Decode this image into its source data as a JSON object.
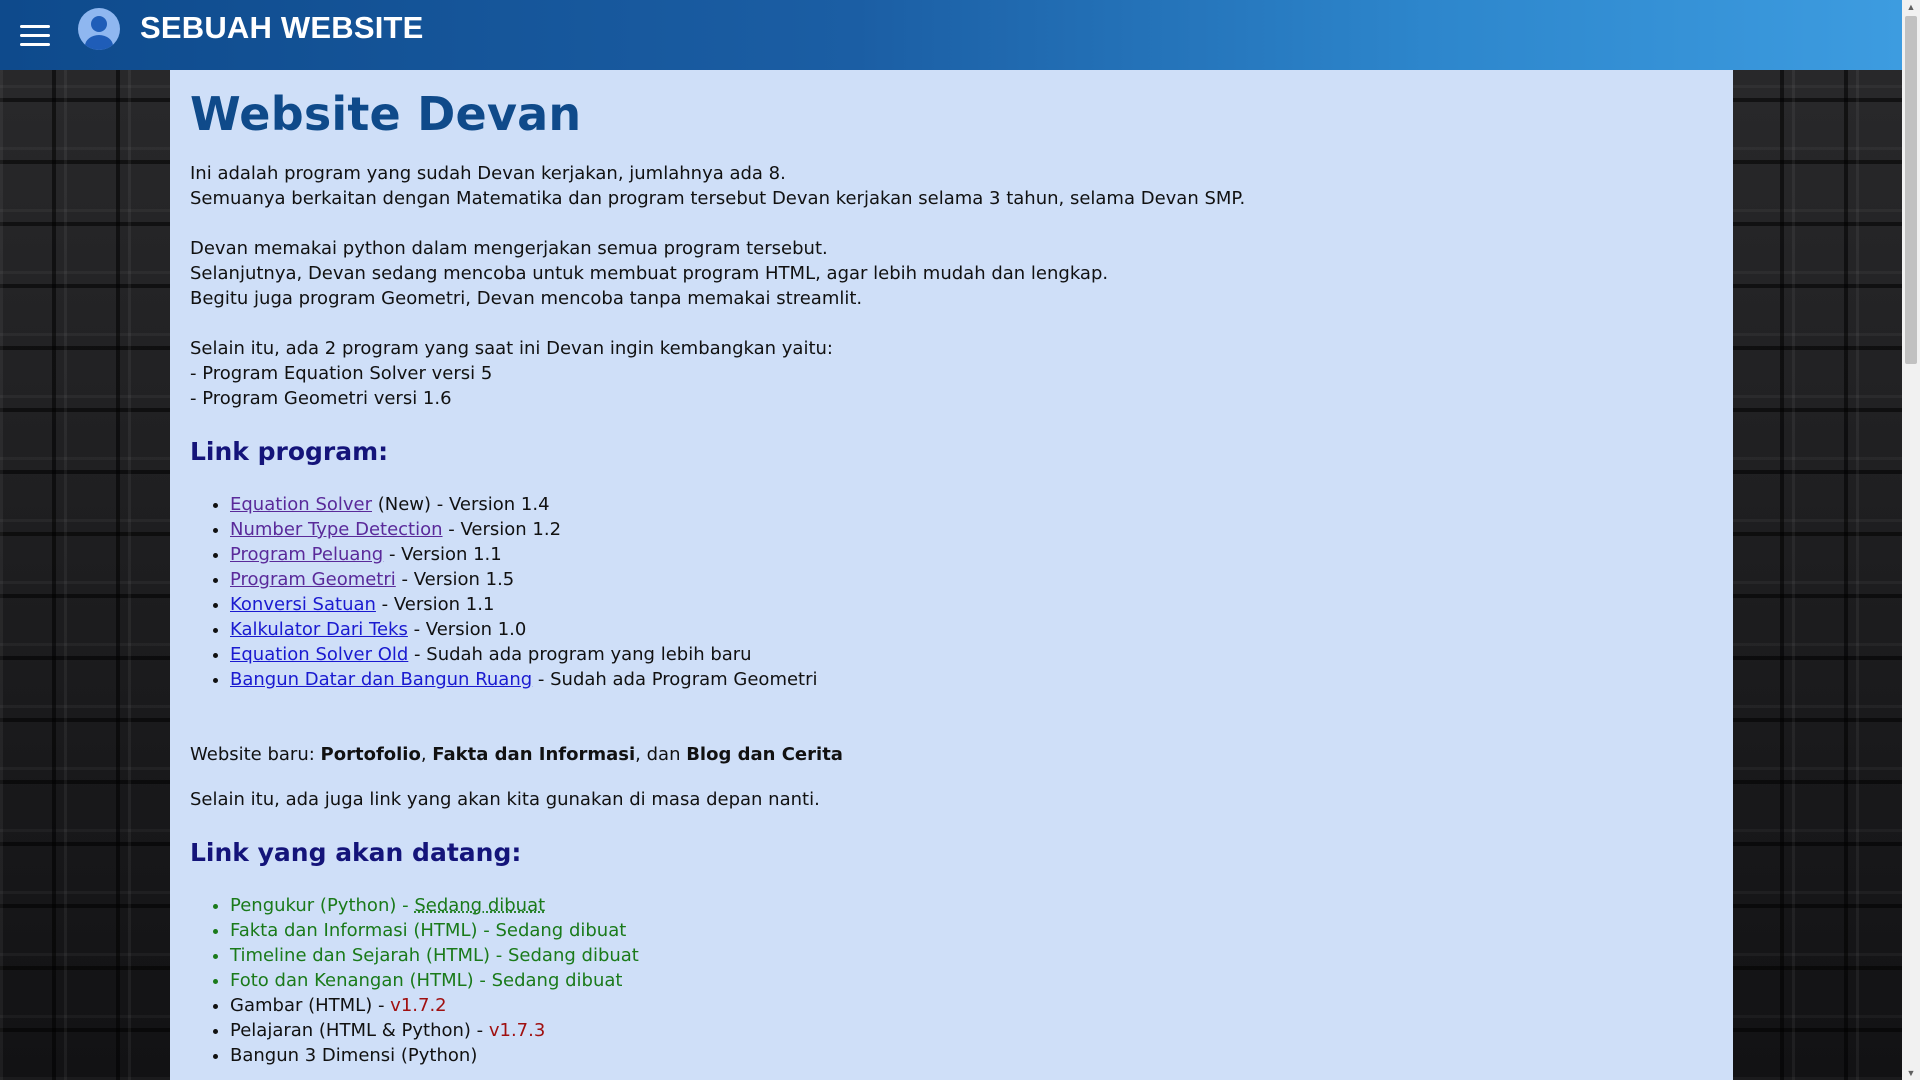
{
  "header": {
    "site_title": "SEBUAH WEBSITE",
    "menu_icon": "hamburger-menu-icon",
    "avatar_icon": "user-avatar-icon",
    "accent_color": "#1b5ea4"
  },
  "main": {
    "title": "Website Devan",
    "intro": [
      "Ini adalah program yang sudah Devan kerjakan, jumlahnya ada 8.",
      "Semuanya berkaitan dengan Matematika dan program tersebut Devan kerjakan selama 3 tahun, selama Devan SMP."
    ],
    "python_para": [
      "Devan memakai python dalam mengerjakan semua program tersebut.",
      "Selanjutnya, Devan sedang mencoba untuk membuat program HTML, agar lebih mudah dan lengkap.",
      "Begitu juga program Geometri, Devan mencoba tanpa memakai streamlit."
    ],
    "develop_para": [
      "Selain itu, ada 2 program yang saat ini Devan ingin kembangkan yaitu:",
      "- Program Equation Solver versi 5",
      "- Program Geometri versi 1.6"
    ],
    "link_program_heading": "Link program:",
    "programs": [
      {
        "link": "Equation Solver",
        "suffix": " (New) - Version 1.4"
      },
      {
        "link": "Number Type Detection",
        "suffix": " - Version 1.2"
      },
      {
        "link": "Program Peluang",
        "suffix": " - Version 1.1"
      },
      {
        "link": "Program Geometri",
        "suffix": " - Version 1.5"
      },
      {
        "link": "Konversi Satuan",
        "suffix": " - Version 1.1"
      },
      {
        "link": "Kalkulator Dari Teks",
        "suffix": " - Version 1.0"
      },
      {
        "link": "Equation Solver Old",
        "suffix": " - Sudah ada program yang lebih baru"
      },
      {
        "link": "Bangun Datar dan Bangun Ruang",
        "suffix": " - Sudah ada Program Geometri"
      }
    ],
    "new_website": {
      "prefix": "Website baru: ",
      "item1": "Portofolio",
      "sep1": ", ",
      "item2": "Fakta dan Informasi",
      "sep2": ", dan ",
      "item3": "Blog dan Cerita"
    },
    "future_note": "Selain itu, ada juga link yang akan kita gunakan di masa depan nanti.",
    "upcoming_heading": "Link yang akan datang:",
    "upcoming": {
      "pengukur": {
        "text": "Pengukur (Python) - ",
        "link": "Sedang dibuat"
      },
      "fakta": "Fakta dan Informasi (HTML) - Sedang dibuat",
      "timeline": "Timeline dan Sejarah (HTML) - Sedang dibuat",
      "foto": "Foto dan Kenangan (HTML) - Sedang dibuat",
      "gambar": {
        "text": "Gambar (HTML) - ",
        "version": "v1.7.2"
      },
      "pelajaran": {
        "text": "Pelajaran (HTML & Python) - ",
        "version": "v1.7.3"
      },
      "bangun3d": "Bangun 3 Dimensi (Python)"
    }
  }
}
